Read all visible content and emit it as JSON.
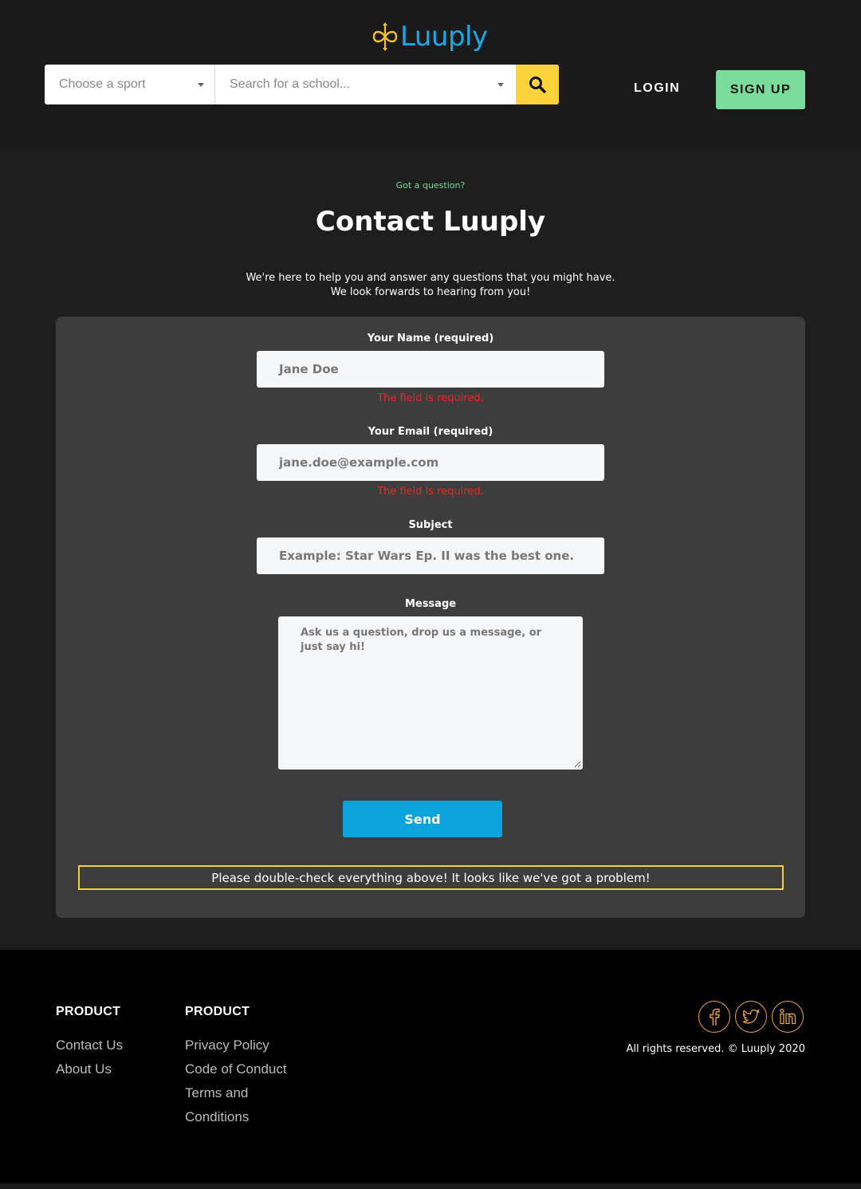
{
  "header": {
    "logo_text": "Luuply",
    "sport_placeholder": "Choose a sport",
    "school_placeholder": "Search for a school...",
    "login_label": "LOGIN",
    "signup_label": "SIGN UP"
  },
  "hero": {
    "kicker": "Got a question?",
    "title": "Contact Luuply",
    "intro_line1": "We're here to help you and answer any questions that you might have.",
    "intro_line2": "We look forwards to hearing from you!"
  },
  "form": {
    "name_label": "Your Name (required)",
    "name_placeholder": "Jane Doe",
    "name_error": "The field is required.",
    "email_label": "Your Email (required)",
    "email_placeholder": "jane.doe@example.com",
    "email_error": "The field is required.",
    "subject_label": "Subject",
    "subject_placeholder": "Example: Star Wars Ep. II was the best one.",
    "message_label": "Message",
    "message_placeholder": "Ask us a question, drop us a message, or just say hi!",
    "send_label": "Send",
    "alert": "Please double-check everything above! It looks like we've got a problem!"
  },
  "footer": {
    "col1": {
      "heading": "PRODUCT",
      "links": [
        "Contact Us",
        "About Us"
      ]
    },
    "col2": {
      "heading": "PRODUCT",
      "links": [
        "Privacy Policy",
        "Code of Conduct",
        "Terms and",
        "Conditions"
      ]
    },
    "socials": [
      "facebook-icon",
      "twitter-icon",
      "linkedin-icon"
    ],
    "copyright": "All rights reserved. © Luuply 2020"
  },
  "colors": {
    "accent_blue": "#0aa3dd",
    "accent_yellow": "#fdd33b",
    "accent_green": "#79dc9a",
    "error_red": "#ff1f1f",
    "social_orange": "#e8a33c"
  }
}
